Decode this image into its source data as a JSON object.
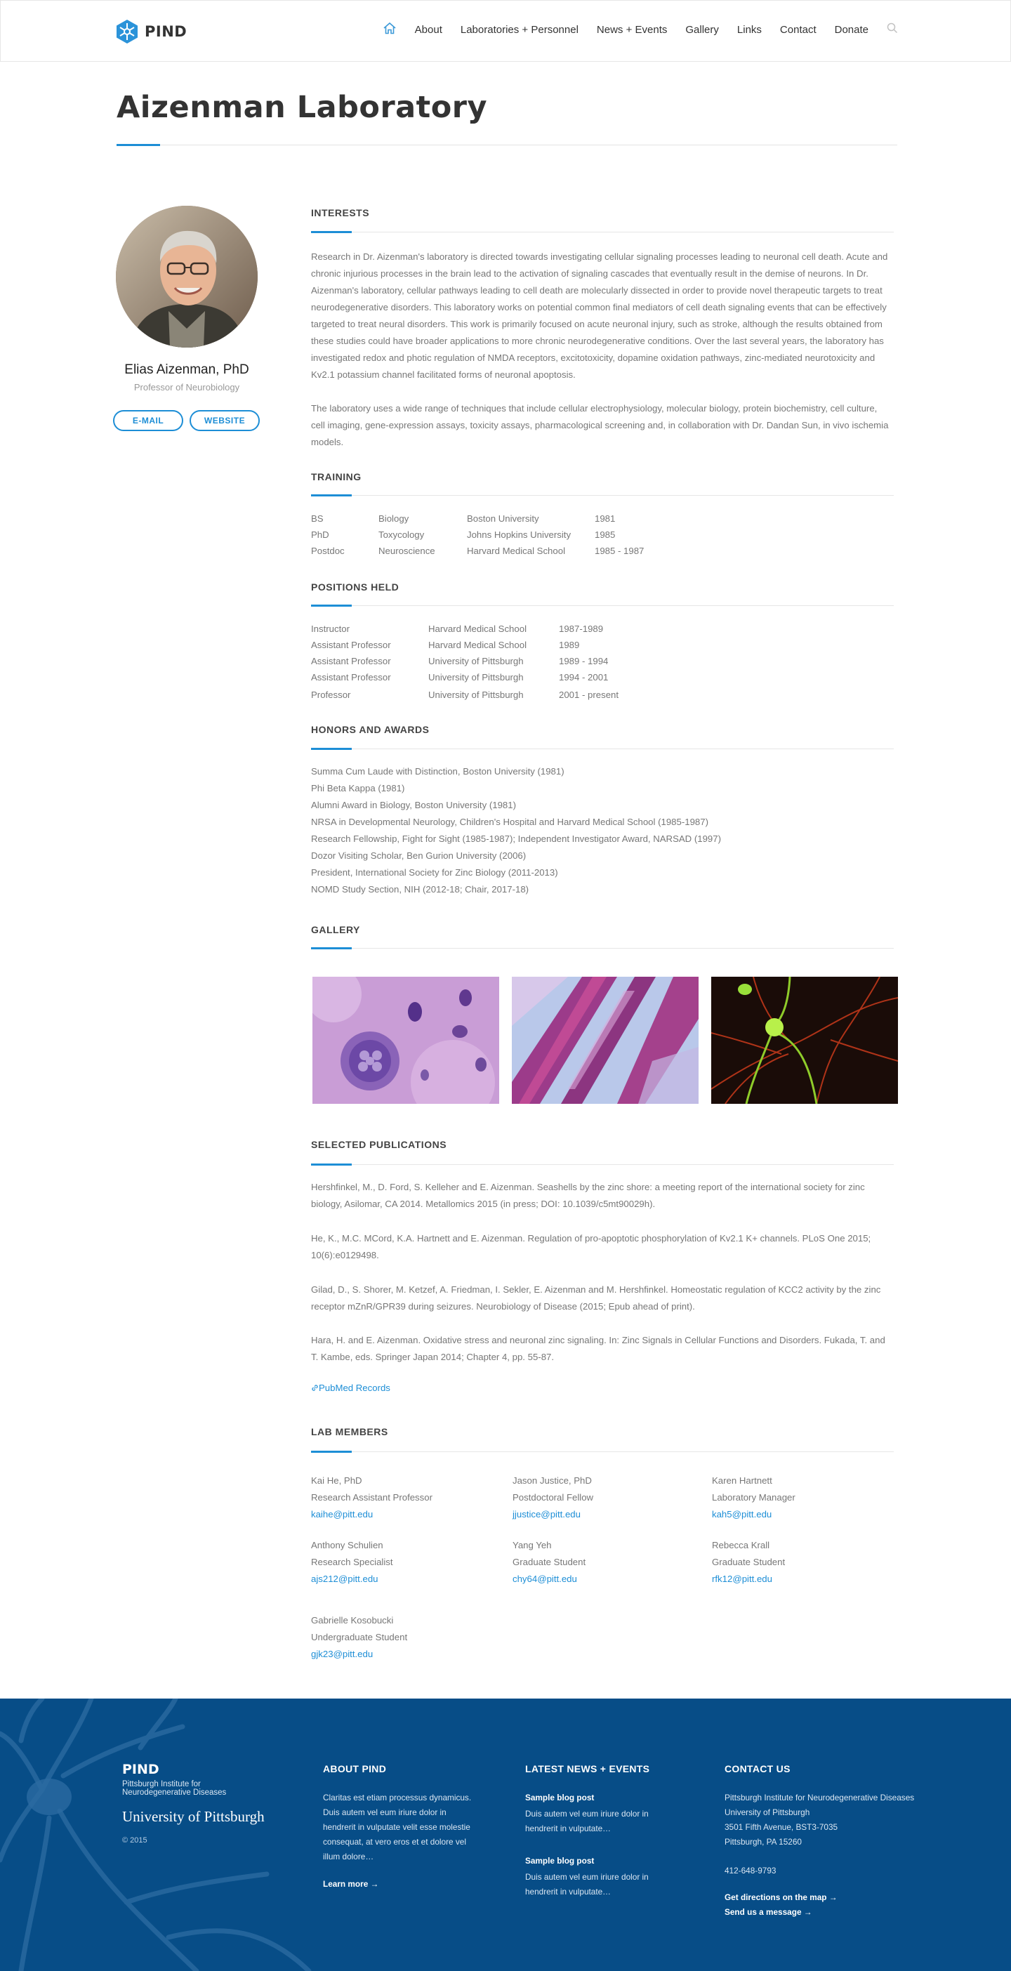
{
  "brand": {
    "name": "PIND"
  },
  "nav": {
    "home_icon": "home-icon",
    "items": [
      "About",
      "Laboratories + Personnel",
      "News + Events",
      "Gallery",
      "Links",
      "Contact",
      "Donate"
    ],
    "search_icon": "search-icon"
  },
  "page": {
    "title": "Aizenman Laboratory"
  },
  "profile": {
    "name": "Elias Aizenman, PhD",
    "role": "Professor of Neurobiology",
    "email_label": "E-MAIL",
    "website_label": "WEBSITE"
  },
  "interests": {
    "heading": "INTERESTS",
    "p1": "Research in Dr. Aizenman's laboratory is directed towards investigating cellular signaling processes leading to neuronal cell death. Acute and chronic injurious processes in the brain lead to the activation of signaling cascades that eventually result in the demise of neurons.  In Dr. Aizenman's laboratory, cellular pathways leading to cell death are molecularly dissected in order to provide novel therapeutic targets to treat neurodegenerative disorders.  This laboratory works on potential common final mediators of cell death signaling events that can be effectively targeted to treat neural disorders.  This work is primarily focused on acute neuronal injury, such as stroke, although the results obtained from these studies could have broader applications to more chronic neurodegenerative conditions.  Over the last several years, the laboratory has investigated redox and photic regulation of NMDA receptors, excitotoxicity, dopamine oxidation pathways, zinc-mediated neurotoxicity and Kv2.1 potassium channel facilitated forms of neuronal apoptosis.",
    "p2": "The laboratory uses a wide range of techniques that include cellular electrophysiology, molecular biology, protein biochemistry, cell culture, cell imaging, gene-expression assays, toxicity assays, pharmacological screening and, in collaboration with Dr. Dandan Sun, in vivo ischemia models."
  },
  "training": {
    "heading": "TRAINING",
    "rows": [
      {
        "degree": "BS",
        "field": "Biology",
        "school": "Boston University",
        "year": "1981"
      },
      {
        "degree": "PhD",
        "field": "Toxycology",
        "school": "Johns Hopkins University",
        "year": "1985"
      },
      {
        "degree": "Postdoc",
        "field": "Neuroscience",
        "school": "Harvard Medical School",
        "year": "1985 - 1987"
      }
    ]
  },
  "positions": {
    "heading": "POSITIONS HELD",
    "rows": [
      {
        "title": "Instructor",
        "place": "Harvard Medical School",
        "years": "1987-1989"
      },
      {
        "title": "Assistant Professor",
        "place": "Harvard Medical School",
        "years": "1989"
      },
      {
        "title": "Assistant Professor",
        "place": "University of Pittsburgh",
        "years": "1989 - 1994"
      },
      {
        "title": "Assistant Professor",
        "place": "University of Pittsburgh",
        "years": "1994 - 2001"
      },
      {
        "title": "Professor",
        "place": "University of Pittsburgh",
        "years": "2001 - present"
      }
    ]
  },
  "honors": {
    "heading": "HONORS AND AWARDS",
    "items": [
      "Summa Cum Laude with Distinction, Boston University (1981)",
      "Phi Beta Kappa (1981)",
      "Alumni Award in Biology, Boston University (1981)",
      "NRSA in Developmental Neurology, Children's Hospital and Harvard Medical School (1985-1987)",
      "Research Fellowship, Fight for Sight (1985-1987); Independent Investigator Award, NARSAD (1997)",
      "Dozor Visiting Scholar, Ben Gurion University (2006)",
      "President, International Society for Zinc Biology (2011-2013)",
      "NOMD Study Section, NIH (2012-18; Chair, 2017-18)"
    ]
  },
  "gallery": {
    "heading": "GALLERY"
  },
  "publications": {
    "heading": "SELECTED PUBLICATIONS",
    "items": [
      "Hershfinkel, M., D. Ford, S. Kelleher and E. Aizenman. Seashells by the zinc shore: a meeting report of the international society for zinc biology, Asilomar, CA 2014. Metallomics 2015 (in press; DOI: 10.1039/c5mt90029h).",
      "He, K., M.C. MCord, K.A. Hartnett and E. Aizenman. Regulation of pro-apoptotic phosphorylation of Kv2.1 K+ channels. PLoS One 2015; 10(6):e0129498.",
      "Gilad, D., S. Shorer, M. Ketzef, A. Friedman, I. Sekler, E. Aizenman and M. Hershfinkel. Homeostatic regulation of KCC2 activity by the zinc receptor mZnR/GPR39 during seizures. Neurobiology of Disease (2015; Epub ahead of print).",
      "Hara, H. and E. Aizenman. Oxidative stress and neuronal zinc signaling. In: Zinc Signals in Cellular Functions and Disorders. Fukada, T. and T. Kambe, eds. Springer Japan 2014; Chapter 4, pp. 55-87."
    ],
    "pubmed_label": "PubMed Records"
  },
  "lab_members": {
    "heading": "LAB MEMBERS",
    "members": [
      {
        "name": "Kai He, PhD",
        "role": "Research Assistant Professor",
        "email": "kaihe@pitt.edu"
      },
      {
        "name": "Jason Justice, PhD",
        "role": "Postdoctoral Fellow",
        "email": "jjustice@pitt.edu"
      },
      {
        "name": "Karen Hartnett",
        "role": "Laboratory Manager",
        "email": "kah5@pitt.edu"
      },
      {
        "name": "Anthony Schulien",
        "role": "Research Specialist",
        "email": "ajs212@pitt.edu"
      },
      {
        "name": "Yang Yeh",
        "role": "Graduate Student",
        "email": "chy64@pitt.edu"
      },
      {
        "name": "Rebecca Krall",
        "role": "Graduate Student",
        "email": "rfk12@pitt.edu"
      },
      {
        "name": "Gabrielle Kosobucki",
        "role": "Undergraduate Student",
        "email": "gjk23@pitt.edu"
      }
    ]
  },
  "footer": {
    "logo": "PIND",
    "subtitle": "Pittsburgh Institute for Neurodegenerative Diseases",
    "university": "University of Pittsburgh",
    "copyright": "© 2015",
    "about": {
      "heading": "ABOUT PIND",
      "text": "Claritas est etiam processus dynamicus. Duis autem vel eum iriure dolor in hendrerit in vulputate velit esse molestie consequat, at vero eros et  et dolore vel illum dolore…",
      "link": "Learn more →"
    },
    "news": {
      "heading": "LATEST NEWS + EVENTS",
      "posts": [
        {
          "title": "Sample blog post",
          "text": "Duis autem vel eum iriure dolor in hendrerit in vulputate…"
        },
        {
          "title": "Sample blog post",
          "text": "Duis autem vel eum iriure dolor in hendrerit in vulputate…"
        }
      ]
    },
    "contact": {
      "heading": "CONTACT US",
      "lines": [
        "Pittsburgh Institute for Neurodegenerative Diseases",
        "University of Pittsburgh",
        "3501 Fifth Avenue, BST3-7035",
        "Pittsburgh, PA 15260"
      ],
      "phone": "412-648-9793",
      "directions": "Get directions on the map →",
      "message": "Send us a message →"
    }
  },
  "colors": {
    "accent": "#1d8ed6",
    "footer_bg": "#074d87",
    "heading": "#333333",
    "text": "#777777"
  }
}
